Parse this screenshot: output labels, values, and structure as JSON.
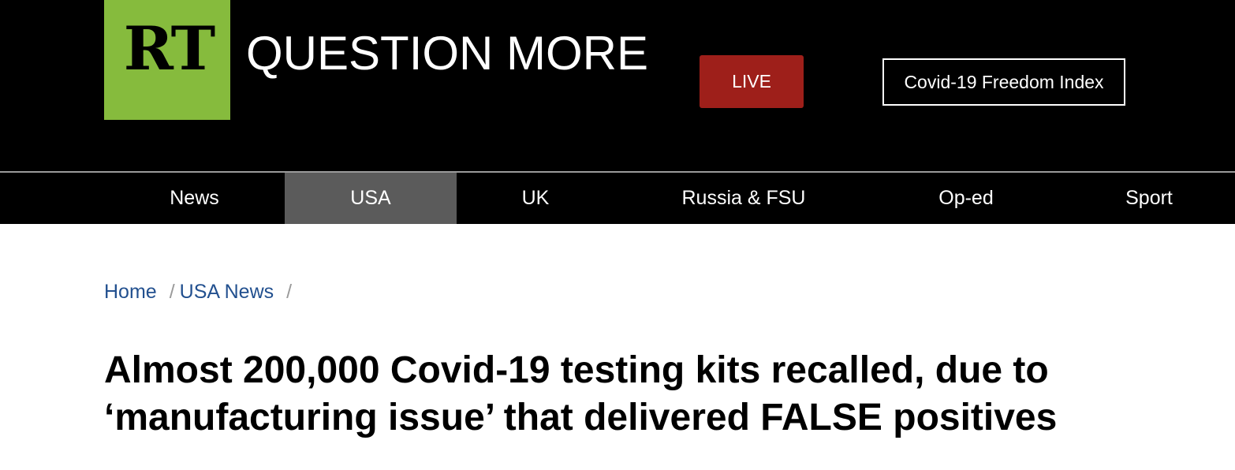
{
  "header": {
    "logo_text": "RT",
    "slogan": "QUESTION MORE",
    "live_label": "LIVE",
    "freedom_index_label": "Covid-19 Freedom Index"
  },
  "nav": {
    "items": [
      {
        "label": "News"
      },
      {
        "label": "USA",
        "active": true
      },
      {
        "label": "UK"
      },
      {
        "label": "Russia & FSU"
      },
      {
        "label": "Op-ed"
      },
      {
        "label": "Sport"
      }
    ]
  },
  "breadcrumb": {
    "items": [
      "Home",
      "USA News"
    ],
    "separator": "/"
  },
  "article": {
    "headline": "Almost 200,000 Covid-19 testing kits recalled, due to ‘manufacturing issue’ that delivered FALSE positives"
  },
  "colors": {
    "brand_green": "#86bb3d",
    "live_red": "#9e1f1a",
    "nav_active": "#5b5b5b",
    "link_blue": "#22508f"
  }
}
